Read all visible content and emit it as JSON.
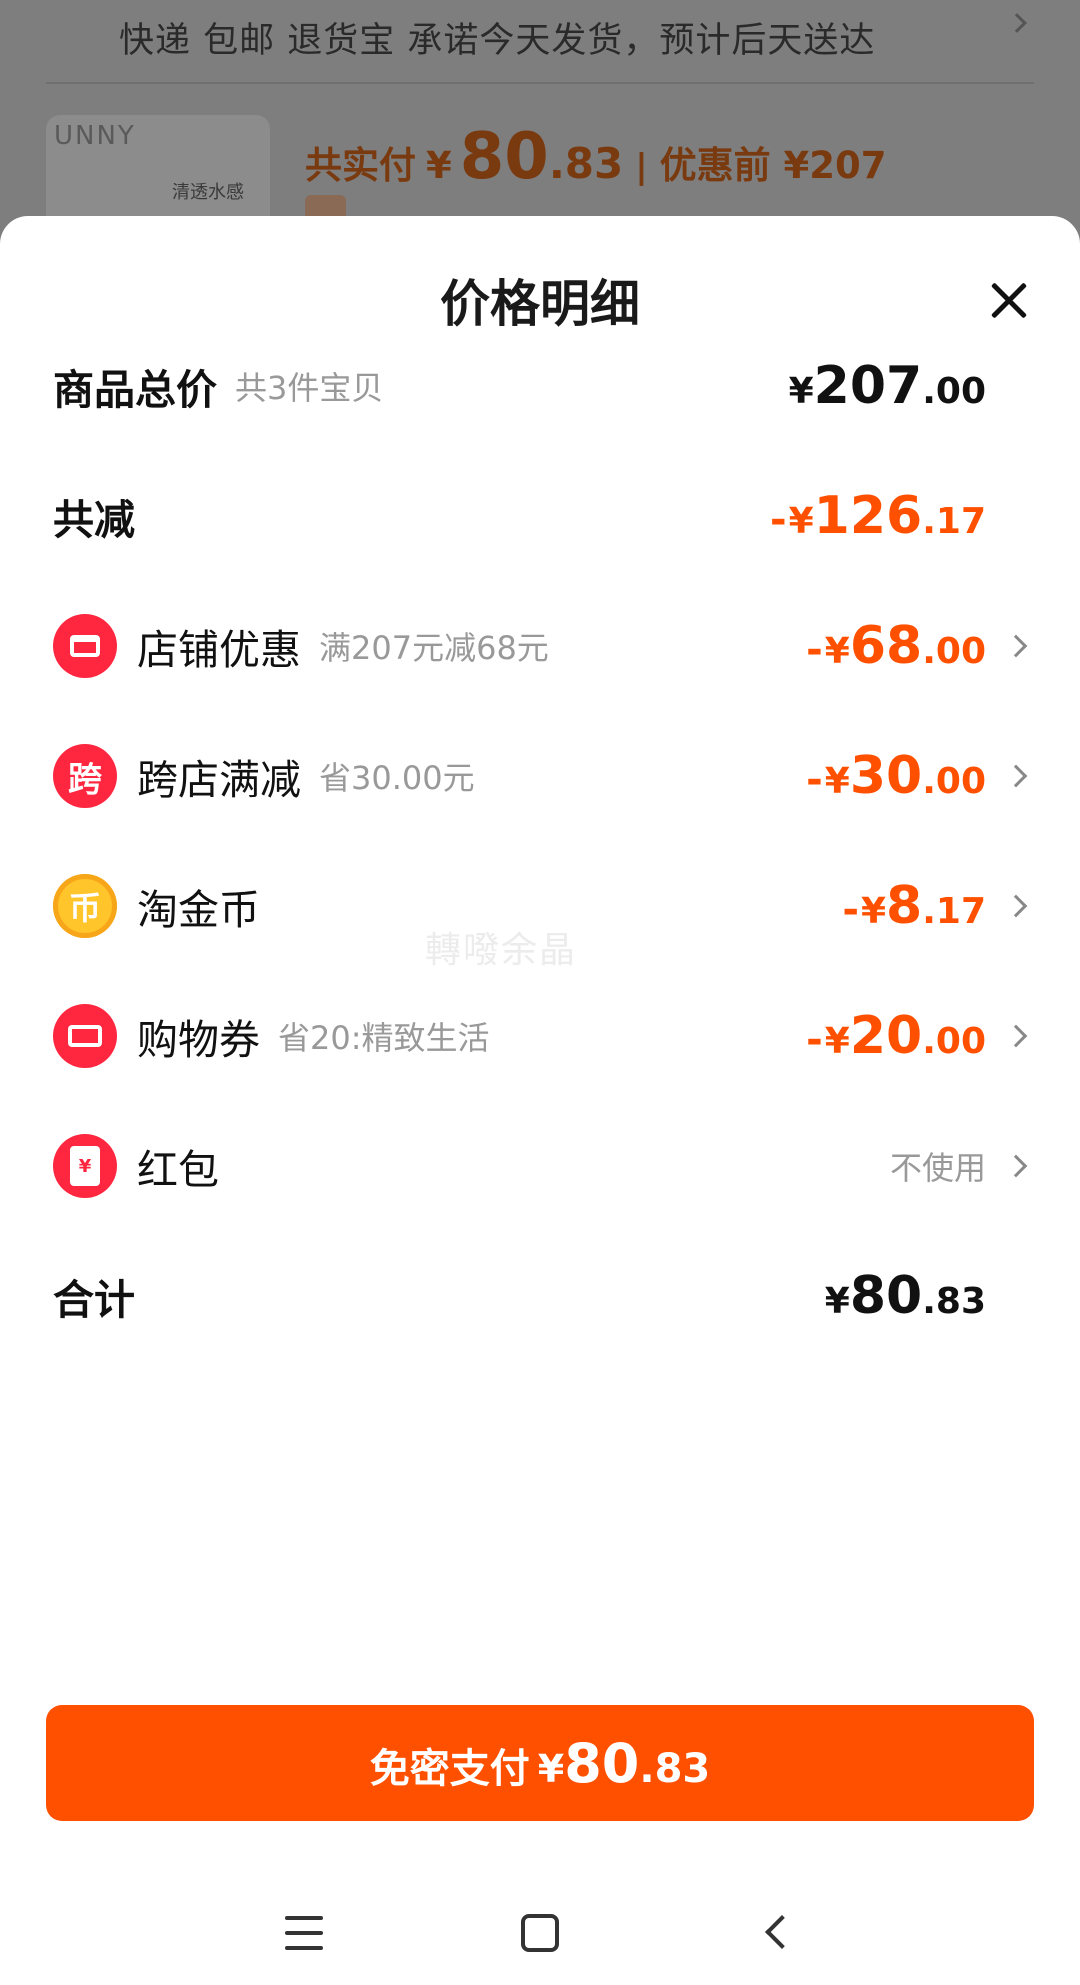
{
  "background": {
    "shipping_text": "快递 包邮 退货宝 承诺今天发货，预计后天送达",
    "thumb_brand": "UNNY",
    "thumb_text": "清透水感",
    "paid_label": "共实付",
    "paid_yen": "¥",
    "paid_int": "80",
    "paid_dec": ".83",
    "separator": "|",
    "before_label": "优惠前 ¥207"
  },
  "sheet": {
    "title": "价格明细"
  },
  "rows": {
    "total": {
      "label": "商品总价",
      "sub": "共3件宝贝",
      "yen": "¥",
      "int": "207",
      "dec": ".00"
    },
    "reduce": {
      "label": "共减",
      "minus": "-",
      "yen": "¥",
      "int": "126",
      "dec": ".17"
    },
    "shop": {
      "label": "店铺优惠",
      "sub": "满207元减68元",
      "minus": "-",
      "yen": "¥",
      "int": "68",
      "dec": ".00",
      "icon": "shop-icon"
    },
    "cross": {
      "label": "跨店满减",
      "sub": "省30.00元",
      "minus": "-",
      "yen": "¥",
      "int": "30",
      "dec": ".00",
      "icon_text": "跨"
    },
    "coin": {
      "label": "淘金币",
      "minus": "-",
      "yen": "¥",
      "int": "8",
      "dec": ".17",
      "icon_text": "币"
    },
    "voucher": {
      "label": "购物券",
      "sub": "省20:精致生活",
      "minus": "-",
      "yen": "¥",
      "int": "20",
      "dec": ".00",
      "icon": "ticket-icon"
    },
    "redpack": {
      "label": "红包",
      "value": "不使用",
      "icon_text": "¥"
    },
    "sum": {
      "label": "合计",
      "yen": "¥",
      "int": "80",
      "dec": ".83"
    }
  },
  "watermark": "轉㗶余晶",
  "pay_button": {
    "label": "免密支付",
    "yen": "¥",
    "int": "80",
    "dec": ".83"
  },
  "colors": {
    "accent": "#ff5000",
    "icon_red": "#ff2740",
    "coin": "#ffc52a"
  }
}
